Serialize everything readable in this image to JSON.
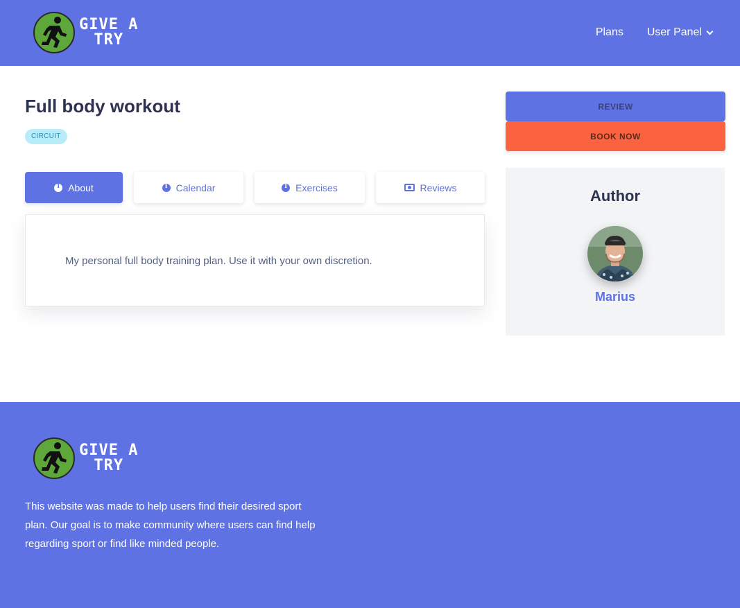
{
  "header": {
    "logo_text_line1": "GIVE A",
    "logo_text_line2": "TRY",
    "nav": {
      "plans": "Plans",
      "user_panel": "User Panel"
    }
  },
  "plan": {
    "title": "Full body workout",
    "badge": "CIRCUIT",
    "tabs": [
      {
        "label": "About",
        "icon": "info-icon",
        "active": true
      },
      {
        "label": "Calendar",
        "icon": "info-icon",
        "active": false
      },
      {
        "label": "Exercises",
        "icon": "info-icon",
        "active": false
      },
      {
        "label": "Reviews",
        "icon": "money-icon",
        "active": false
      }
    ],
    "about_text": "My personal full body training plan. Use it with your own discretion."
  },
  "actions": {
    "review": "REVIEW",
    "book_now": "BOOK NOW"
  },
  "author": {
    "heading": "Author",
    "name": "Marius"
  },
  "footer": {
    "logo_text_line1": "GIVE A",
    "logo_text_line2": "TRY",
    "description": "This website was made to help users find their desired sport plan. Our goal is to make community where users can find help regarding sport or find like minded people."
  },
  "colors": {
    "primary": "#5e72e4",
    "accent_orange": "#fb6340",
    "badge_bg": "#b8ecf8",
    "logo_green": "#5ea73a"
  }
}
